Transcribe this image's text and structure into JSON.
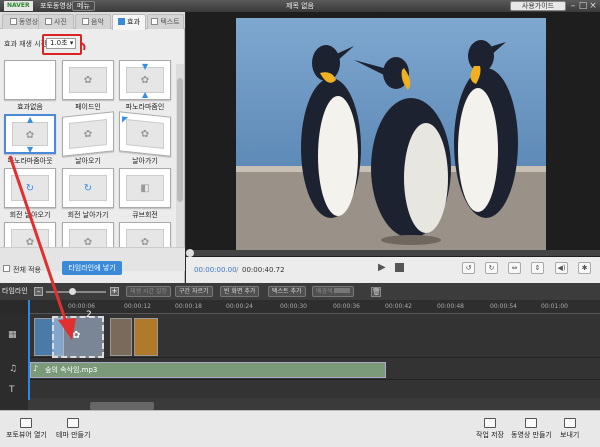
{
  "titlebar": {
    "logo": "NAVER",
    "app_name": "포토동영상",
    "menu": "메뉴",
    "title": "제목 없음",
    "help": "사용가이드",
    "min": "–",
    "max": "□",
    "close": "×"
  },
  "tabs": [
    {
      "label": "동영상"
    },
    {
      "label": "사진"
    },
    {
      "label": "음악"
    },
    {
      "label": "효과"
    },
    {
      "label": "텍스트"
    }
  ],
  "effects_panel": {
    "duration_label": "효과 재생 시간",
    "duration_value": "1.0초",
    "effects": [
      {
        "label": "효과없음"
      },
      {
        "label": "페이드인"
      },
      {
        "label": "파노라마줌인"
      },
      {
        "label": "파노라마줌아웃"
      },
      {
        "label": "날아오기"
      },
      {
        "label": "날아가기"
      },
      {
        "label": "회전 날아오기"
      },
      {
        "label": "회전 날아가기"
      },
      {
        "label": "큐브회전"
      },
      {
        "label": ""
      },
      {
        "label": ""
      },
      {
        "label": ""
      }
    ],
    "apply_all": "전체 적용",
    "add_to_timeline": "타임라인에 넣기"
  },
  "preview": {
    "time_current": "00:00:00.00",
    "time_total": "00:00:40.72"
  },
  "timeline": {
    "label": "타임라인",
    "buttons": [
      "재생 시간 설정",
      "구간 자르기",
      "빈 화면 추가",
      "텍스트 추가",
      "배경색"
    ],
    "ticks": [
      "00:00:06",
      "00:00:12",
      "00:00:18",
      "00:00:24",
      "00:00:30",
      "00:00:36",
      "00:00:42",
      "00:00:48",
      "00:00:54",
      "00:01:00"
    ],
    "audio_clip": "숲의 속삭임.mp3",
    "drop_number": "2"
  },
  "bottom": {
    "left": [
      {
        "label": "포토뷰어 열기"
      },
      {
        "label": "테마 만들기"
      }
    ],
    "right": [
      {
        "label": "작업 저장"
      },
      {
        "label": "동영상 만들기"
      },
      {
        "label": "보내기"
      }
    ]
  },
  "colors": {
    "accent": "#3a8ad8",
    "highlight": "#d22222"
  }
}
